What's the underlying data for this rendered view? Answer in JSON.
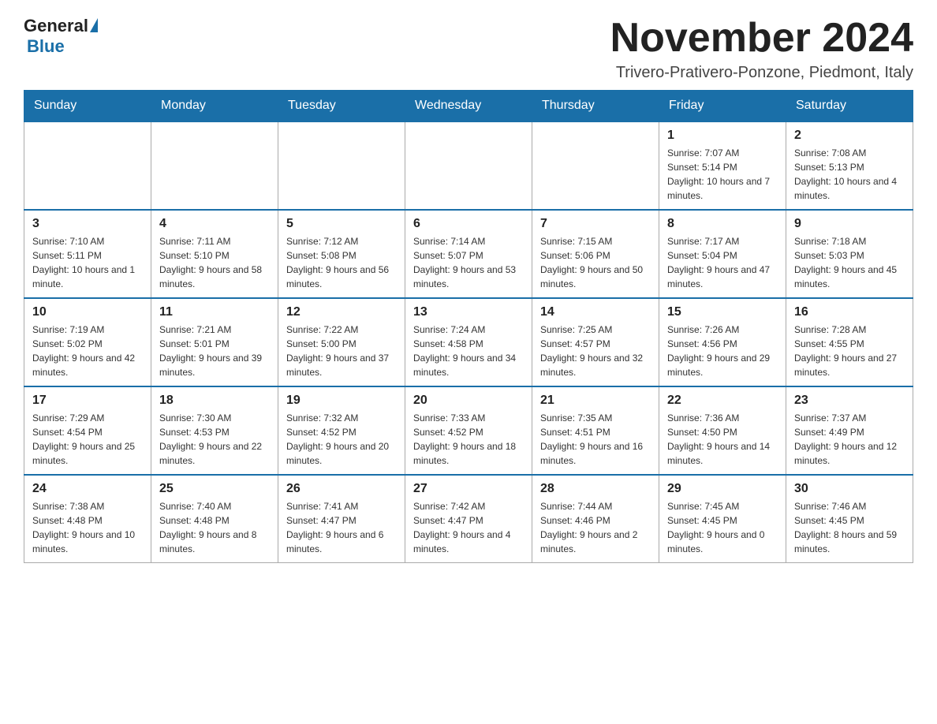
{
  "header": {
    "logo_general": "General",
    "logo_blue": "Blue",
    "month_title": "November 2024",
    "location": "Trivero-Prativero-Ponzone, Piedmont, Italy"
  },
  "weekdays": [
    "Sunday",
    "Monday",
    "Tuesday",
    "Wednesday",
    "Thursday",
    "Friday",
    "Saturday"
  ],
  "weeks": [
    [
      {
        "day": "",
        "info": ""
      },
      {
        "day": "",
        "info": ""
      },
      {
        "day": "",
        "info": ""
      },
      {
        "day": "",
        "info": ""
      },
      {
        "day": "",
        "info": ""
      },
      {
        "day": "1",
        "info": "Sunrise: 7:07 AM\nSunset: 5:14 PM\nDaylight: 10 hours and 7 minutes."
      },
      {
        "day": "2",
        "info": "Sunrise: 7:08 AM\nSunset: 5:13 PM\nDaylight: 10 hours and 4 minutes."
      }
    ],
    [
      {
        "day": "3",
        "info": "Sunrise: 7:10 AM\nSunset: 5:11 PM\nDaylight: 10 hours and 1 minute."
      },
      {
        "day": "4",
        "info": "Sunrise: 7:11 AM\nSunset: 5:10 PM\nDaylight: 9 hours and 58 minutes."
      },
      {
        "day": "5",
        "info": "Sunrise: 7:12 AM\nSunset: 5:08 PM\nDaylight: 9 hours and 56 minutes."
      },
      {
        "day": "6",
        "info": "Sunrise: 7:14 AM\nSunset: 5:07 PM\nDaylight: 9 hours and 53 minutes."
      },
      {
        "day": "7",
        "info": "Sunrise: 7:15 AM\nSunset: 5:06 PM\nDaylight: 9 hours and 50 minutes."
      },
      {
        "day": "8",
        "info": "Sunrise: 7:17 AM\nSunset: 5:04 PM\nDaylight: 9 hours and 47 minutes."
      },
      {
        "day": "9",
        "info": "Sunrise: 7:18 AM\nSunset: 5:03 PM\nDaylight: 9 hours and 45 minutes."
      }
    ],
    [
      {
        "day": "10",
        "info": "Sunrise: 7:19 AM\nSunset: 5:02 PM\nDaylight: 9 hours and 42 minutes."
      },
      {
        "day": "11",
        "info": "Sunrise: 7:21 AM\nSunset: 5:01 PM\nDaylight: 9 hours and 39 minutes."
      },
      {
        "day": "12",
        "info": "Sunrise: 7:22 AM\nSunset: 5:00 PM\nDaylight: 9 hours and 37 minutes."
      },
      {
        "day": "13",
        "info": "Sunrise: 7:24 AM\nSunset: 4:58 PM\nDaylight: 9 hours and 34 minutes."
      },
      {
        "day": "14",
        "info": "Sunrise: 7:25 AM\nSunset: 4:57 PM\nDaylight: 9 hours and 32 minutes."
      },
      {
        "day": "15",
        "info": "Sunrise: 7:26 AM\nSunset: 4:56 PM\nDaylight: 9 hours and 29 minutes."
      },
      {
        "day": "16",
        "info": "Sunrise: 7:28 AM\nSunset: 4:55 PM\nDaylight: 9 hours and 27 minutes."
      }
    ],
    [
      {
        "day": "17",
        "info": "Sunrise: 7:29 AM\nSunset: 4:54 PM\nDaylight: 9 hours and 25 minutes."
      },
      {
        "day": "18",
        "info": "Sunrise: 7:30 AM\nSunset: 4:53 PM\nDaylight: 9 hours and 22 minutes."
      },
      {
        "day": "19",
        "info": "Sunrise: 7:32 AM\nSunset: 4:52 PM\nDaylight: 9 hours and 20 minutes."
      },
      {
        "day": "20",
        "info": "Sunrise: 7:33 AM\nSunset: 4:52 PM\nDaylight: 9 hours and 18 minutes."
      },
      {
        "day": "21",
        "info": "Sunrise: 7:35 AM\nSunset: 4:51 PM\nDaylight: 9 hours and 16 minutes."
      },
      {
        "day": "22",
        "info": "Sunrise: 7:36 AM\nSunset: 4:50 PM\nDaylight: 9 hours and 14 minutes."
      },
      {
        "day": "23",
        "info": "Sunrise: 7:37 AM\nSunset: 4:49 PM\nDaylight: 9 hours and 12 minutes."
      }
    ],
    [
      {
        "day": "24",
        "info": "Sunrise: 7:38 AM\nSunset: 4:48 PM\nDaylight: 9 hours and 10 minutes."
      },
      {
        "day": "25",
        "info": "Sunrise: 7:40 AM\nSunset: 4:48 PM\nDaylight: 9 hours and 8 minutes."
      },
      {
        "day": "26",
        "info": "Sunrise: 7:41 AM\nSunset: 4:47 PM\nDaylight: 9 hours and 6 minutes."
      },
      {
        "day": "27",
        "info": "Sunrise: 7:42 AM\nSunset: 4:47 PM\nDaylight: 9 hours and 4 minutes."
      },
      {
        "day": "28",
        "info": "Sunrise: 7:44 AM\nSunset: 4:46 PM\nDaylight: 9 hours and 2 minutes."
      },
      {
        "day": "29",
        "info": "Sunrise: 7:45 AM\nSunset: 4:45 PM\nDaylight: 9 hours and 0 minutes."
      },
      {
        "day": "30",
        "info": "Sunrise: 7:46 AM\nSunset: 4:45 PM\nDaylight: 8 hours and 59 minutes."
      }
    ]
  ]
}
